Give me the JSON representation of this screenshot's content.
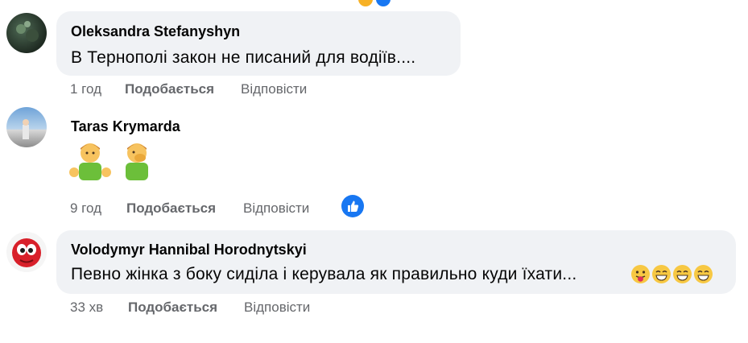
{
  "comments": [
    {
      "author": "Oleksandra Stefanyshyn",
      "text": "В Тернополі закон не писаний для водіїв....",
      "time": "1 год",
      "like_label": "Подобається",
      "reply_label": "Відповісти"
    },
    {
      "author": "Taras Krymarda",
      "text": "🤷‍♂️🤦‍♂️",
      "time": "9 год",
      "like_label": "Подобається",
      "reply_label": "Відповісти",
      "reaction_icon": "like-icon"
    },
    {
      "author": "Volodymyr Hannibal Horodnytskyi",
      "text": "Певно жінка з боку сиділа і керувала як правильно куди їхати...",
      "time": "33 хв",
      "like_label": "Подобається",
      "reply_label": "Відповісти",
      "emojis": [
        "tongue-face-emoji",
        "grin-emoji",
        "grin-emoji",
        "grin-emoji"
      ]
    }
  ],
  "colors": {
    "bubble": "#f0f2f5",
    "meta_text": "#65676b",
    "like_blue": "#1877f2"
  }
}
